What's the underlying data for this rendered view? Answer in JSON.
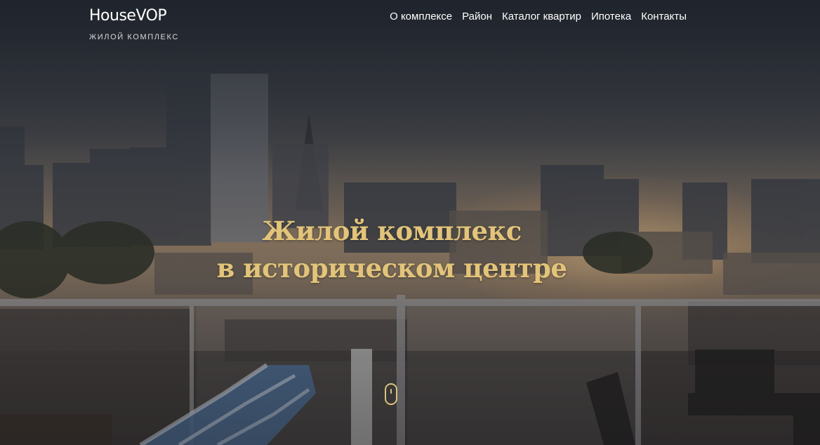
{
  "site": {
    "logo_title": "HouseVOP",
    "logo_subtitle": "ЖИЛОЙ КОМПЛЕКС"
  },
  "nav": {
    "items": [
      {
        "label": "О комплексе"
      },
      {
        "label": "Район"
      },
      {
        "label": "Каталог квартир"
      },
      {
        "label": "Ипотека"
      },
      {
        "label": "Контакты"
      }
    ]
  },
  "hero": {
    "title_line1": "Жилой комплекс",
    "title_line2": "в историческом центре",
    "background": "city-rooftop-terrace-photo"
  },
  "scroll_indicator": {
    "icon": "mouse-scroll-icon"
  },
  "colors": {
    "accent": "#e2c47a",
    "header_bg": "#1f242c",
    "nav_text": "#ffffff"
  }
}
